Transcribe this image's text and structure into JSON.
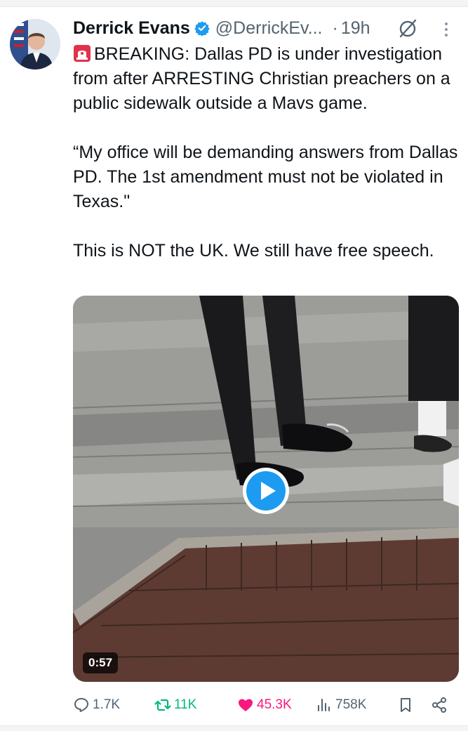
{
  "tweet": {
    "author": {
      "display_name": "Derrick Evans",
      "handle": "@DerrickEv...",
      "verified": true
    },
    "separator": "·",
    "time": "19h",
    "body_lines": [
      "BREAKING: Dallas PD is under investigation from after ARRESTING Christian preachers on a public sidewalk outside a Mavs game.",
      "“My office will be demanding answers from Dallas PD. The 1st amendment must not be violated in Texas.\"",
      "This is NOT the UK. We still have free speech."
    ],
    "media": {
      "type": "video",
      "duration": "0:57"
    },
    "actions": {
      "replies": "1.7K",
      "reposts": "11K",
      "likes": "45.3K",
      "views": "758K"
    },
    "colors": {
      "verified_badge": "#1d9bf0",
      "play_button": "#1d9bf0",
      "repost_active": "#00ba7c",
      "like_active": "#f91880",
      "secondary_text": "#536471"
    },
    "icons": [
      "siren-emoji-icon",
      "verified-badge-icon",
      "grok-icon",
      "more-icon",
      "play-icon",
      "reply-icon",
      "repost-icon",
      "heart-icon",
      "views-icon",
      "bookmark-icon",
      "share-icon"
    ]
  }
}
